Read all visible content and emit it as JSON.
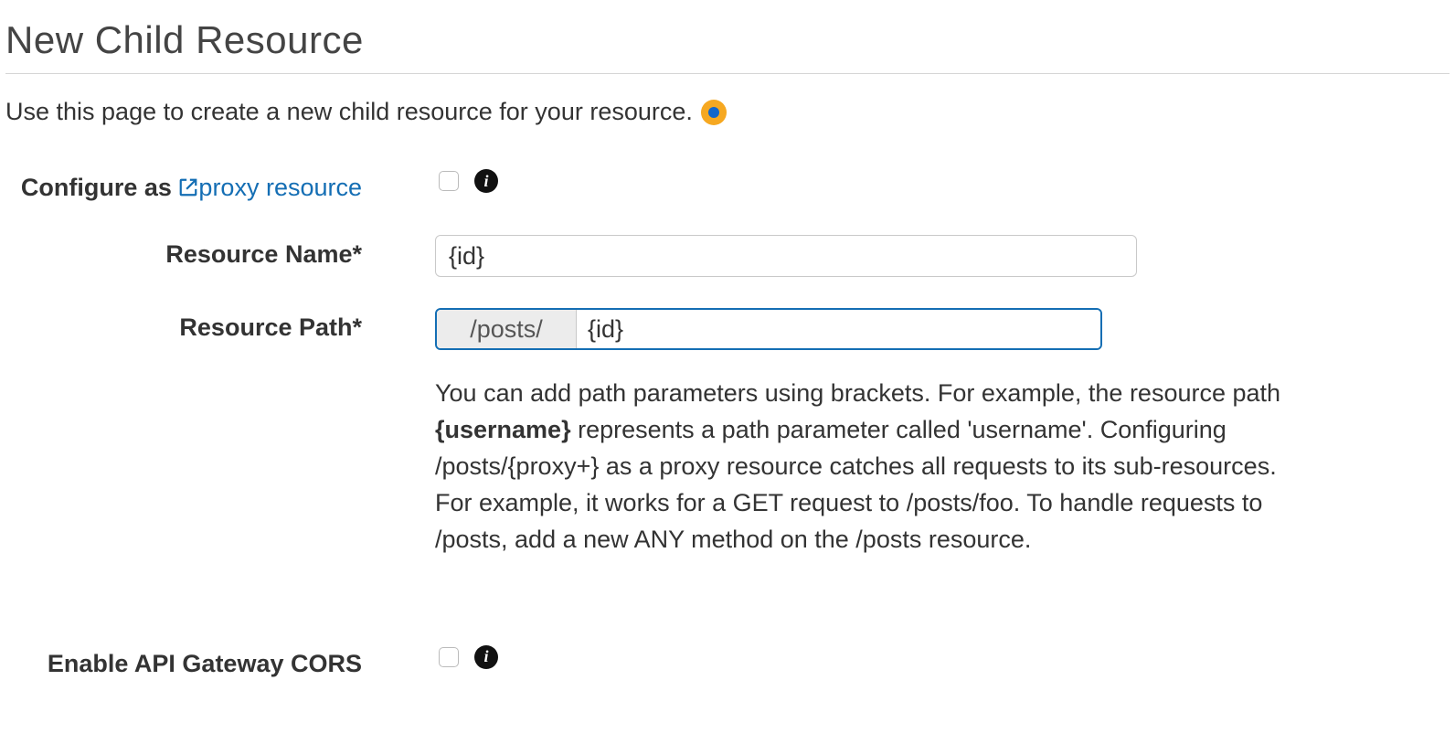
{
  "page": {
    "title": "New Child Resource",
    "intro": "Use this page to create a new child resource for your resource."
  },
  "form": {
    "configure_as": {
      "label_text": "Configure as ",
      "link_text": "proxy resource",
      "checked": false
    },
    "resource_name": {
      "label": "Resource Name*",
      "value": "{id}"
    },
    "resource_path": {
      "label": "Resource Path*",
      "prefix": "/posts/",
      "value": "{id}",
      "help_pre": "You can add path parameters using brackets. For example, the resource path ",
      "help_bold": "{username}",
      "help_post": " represents a path parameter called 'username'. Configuring /posts/{proxy+} as a proxy resource catches all requests to its sub-resources. For example, it works for a GET request to /posts/foo. To handle requests to /posts, add a new ANY method on the /posts resource."
    },
    "cors": {
      "label": "Enable API Gateway CORS",
      "checked": false
    }
  }
}
